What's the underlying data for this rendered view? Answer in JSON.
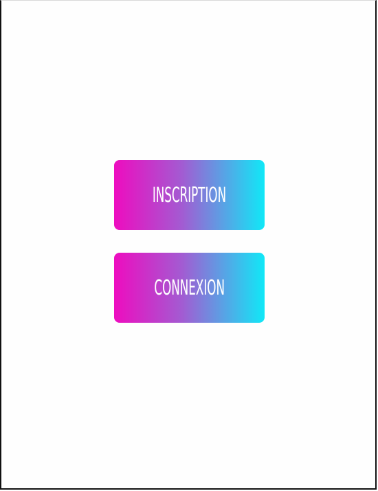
{
  "colors": {
    "gradient_start": "#ee0cbf",
    "gradient_mid": "#a35bd2",
    "gradient_end": "#10e8f7",
    "label": "#ffffff"
  },
  "buttons": {
    "inscription": {
      "label": "INSCRIPTION"
    },
    "connexion": {
      "label": "CONNEXION"
    }
  }
}
